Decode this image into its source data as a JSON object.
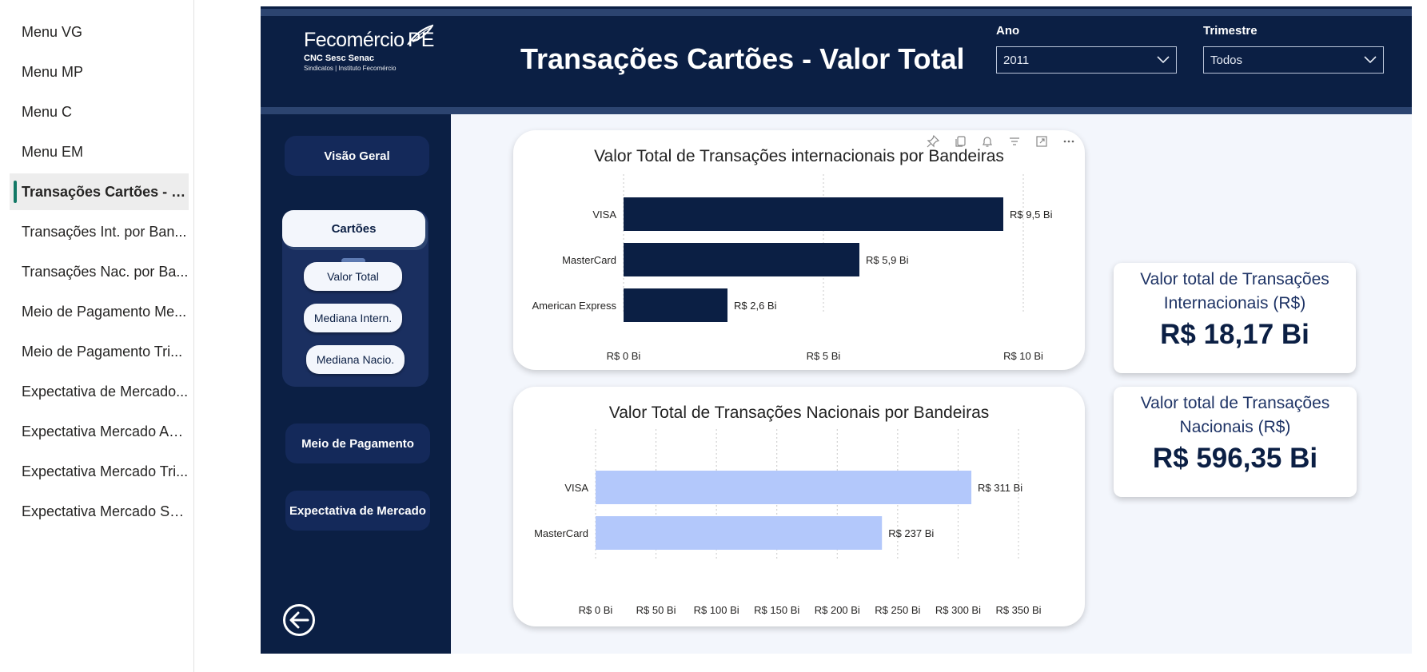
{
  "pages": {
    "items": [
      {
        "label": "Menu VG"
      },
      {
        "label": "Menu MP"
      },
      {
        "label": "Menu C"
      },
      {
        "label": "Menu EM"
      },
      {
        "label": "Transações Cartões - to...",
        "active": true
      },
      {
        "label": "Transações Int. por Ban..."
      },
      {
        "label": "Transações Nac. por Ba..."
      },
      {
        "label": "Meio de Pagamento Me..."
      },
      {
        "label": "Meio de Pagamento Tri..."
      },
      {
        "label": "Expectativa de Mercado..."
      },
      {
        "label": "Expectativa Mercado An..."
      },
      {
        "label": "Expectativa Mercado Tri..."
      },
      {
        "label": "Expectativa Mercado Selic"
      }
    ]
  },
  "header": {
    "logo_brand": "Fecomércio",
    "logo_pe": "PE",
    "logo_sub1": "CNC Sesc Senac",
    "logo_sub2": "Sindicatos | Instituto Fecomércio",
    "title": "Transações Cartões - Valor Total",
    "slicers": {
      "ano": {
        "label": "Ano",
        "value": "2011"
      },
      "trimestre": {
        "label": "Trimestre",
        "value": "Todos"
      }
    }
  },
  "nav": {
    "visao_geral": "Visão Geral",
    "cartoes": "Cartões",
    "valor_total": "Valor Total",
    "mediana_intern": "Mediana Intern.",
    "mediana_nacio": "Mediana Nacio.",
    "meio_pagamento": "Meio de Pagamento",
    "expectativa": "Expectativa de Mercado"
  },
  "colors": {
    "navy": "#0b1f44",
    "bar_international": "#0b1f44",
    "bar_national": "#b3c8fb",
    "active_page_marker": "#117865"
  },
  "icons": [
    "pin-icon",
    "copy-icon",
    "bell-icon",
    "filter-icon",
    "focus-mode-icon",
    "more-options-icon",
    "back-arrow-icon",
    "chevron-down-icon"
  ],
  "chart_data": [
    {
      "type": "bar",
      "orientation": "horizontal",
      "title": "Valor Total de Transações internacionais por Bandeiras",
      "categories": [
        "VISA",
        "MasterCard",
        "American Express"
      ],
      "values": [
        9.5,
        5.9,
        2.6
      ],
      "value_labels": [
        "R$ 9,5 Bi",
        "R$ 5,9 Bi",
        "R$ 2,6 Bi"
      ],
      "xticks": [
        0,
        5,
        10
      ],
      "xtick_labels": [
        "R$ 0 Bi",
        "R$ 5 Bi",
        "R$ 10 Bi"
      ],
      "xlim": [
        0,
        10
      ],
      "grid": true
    },
    {
      "type": "bar",
      "orientation": "horizontal",
      "title": "Valor Total de Transações Nacionais por Bandeiras",
      "categories": [
        "VISA",
        "MasterCard"
      ],
      "values": [
        311,
        237
      ],
      "value_labels": [
        "R$ 311 Bi",
        "R$ 237 Bi"
      ],
      "xticks": [
        0,
        50,
        100,
        150,
        200,
        250,
        300,
        350
      ],
      "xtick_labels": [
        "R$ 0 Bi",
        "R$ 50 Bi",
        "R$ 100 Bi",
        "R$ 150 Bi",
        "R$ 200 Bi",
        "R$ 250 Bi",
        "R$ 300 Bi",
        "R$ 350 Bi"
      ],
      "xlim": [
        0,
        350
      ],
      "grid": true
    }
  ],
  "kpis": {
    "internacional": {
      "label": "Valor total de Transações Internacionais (R$)",
      "value": "R$ 18,17 Bi"
    },
    "nacional": {
      "label": "Valor total de Transações Nacionais (R$)",
      "value": "R$ 596,35 Bi"
    }
  }
}
